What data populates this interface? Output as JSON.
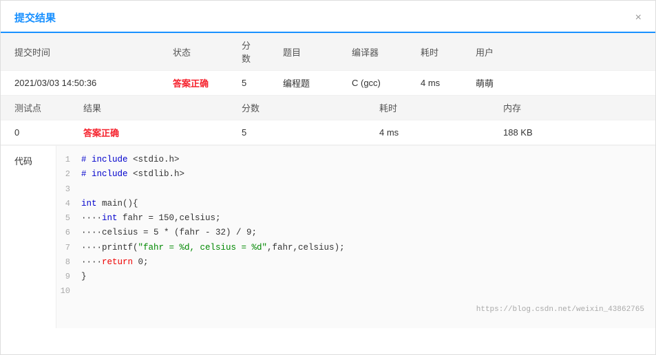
{
  "dialog": {
    "title": "提交结果",
    "close_icon": "×"
  },
  "main_table": {
    "headers": [
      "提交时间",
      "",
      "状态",
      "分数",
      "题目",
      "编译器",
      "耗时",
      "用户"
    ],
    "row": {
      "submit_time": "2021/03/03 14:50:36",
      "status": "答案正确",
      "score": "5",
      "problem": "编程题",
      "compiler": "C (gcc)",
      "time": "4 ms",
      "user": "萌萌"
    }
  },
  "sub_table": {
    "headers": [
      "测试点",
      "结果",
      "",
      "分数",
      "",
      "耗时",
      "",
      "内存"
    ],
    "row": {
      "id": "0",
      "result": "答案正确",
      "score": "5",
      "time": "4 ms",
      "memory": "188 KB"
    }
  },
  "code_section": {
    "label": "代码",
    "lines": [
      {
        "num": "1",
        "tokens": [
          {
            "type": "hash",
            "text": "#"
          },
          {
            "type": "space",
            "text": " "
          },
          {
            "type": "include",
            "text": "include"
          },
          {
            "type": "normal",
            "text": " <stdio.h>"
          }
        ]
      },
      {
        "num": "2",
        "tokens": [
          {
            "type": "hash",
            "text": "#"
          },
          {
            "type": "space",
            "text": " "
          },
          {
            "type": "include",
            "text": "include"
          },
          {
            "type": "normal",
            "text": " <stdlib.h>"
          }
        ]
      },
      {
        "num": "3",
        "tokens": []
      },
      {
        "num": "4",
        "tokens": [
          {
            "type": "kw",
            "text": "int"
          },
          {
            "type": "normal",
            "text": " main(){"
          }
        ]
      },
      {
        "num": "5",
        "tokens": [
          {
            "type": "normal",
            "text": "····int fahr = 150,celsius;"
          }
        ]
      },
      {
        "num": "6",
        "tokens": [
          {
            "type": "normal",
            "text": "····celsius = 5 * (fahr - 32) / 9;"
          }
        ]
      },
      {
        "num": "7",
        "tokens": [
          {
            "type": "normal",
            "text": "····printf("
          },
          {
            "type": "str",
            "text": "\"fahr = %d, celsius = %d\""
          },
          {
            "type": "normal",
            "text": ",fahr,celsius);"
          }
        ]
      },
      {
        "num": "8",
        "tokens": [
          {
            "type": "normal",
            "text": "····"
          },
          {
            "type": "ret",
            "text": "return"
          },
          {
            "type": "normal",
            "text": " 0;"
          }
        ]
      },
      {
        "num": "9",
        "tokens": [
          {
            "type": "normal",
            "text": "}"
          }
        ]
      },
      {
        "num": "10",
        "tokens": []
      }
    ]
  },
  "footer": {
    "link": "https://blog.csdn.net/weixin_43862765"
  }
}
